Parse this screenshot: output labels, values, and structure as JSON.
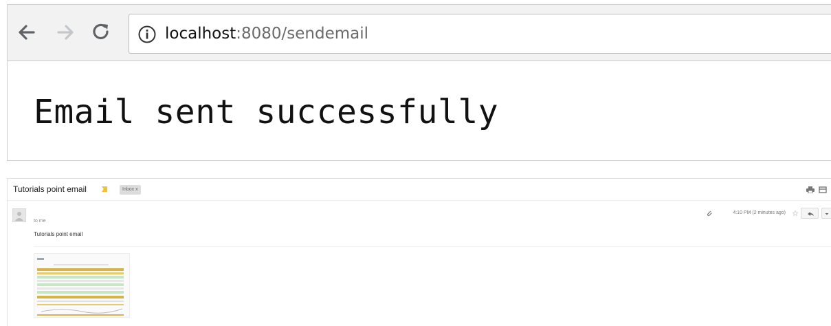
{
  "browser": {
    "url_host": "localhost",
    "url_path": ":8080/sendemail",
    "page_message": "Email sent successfully",
    "icons": [
      "back-arrow-icon",
      "forward-arrow-icon",
      "reload-icon",
      "info-icon"
    ]
  },
  "email": {
    "subject": "Tutorials point email",
    "inbox_label": "Inbox x",
    "sender_name": "to me",
    "timestamp": "4:10 PM (2 minutes ago)",
    "body_text": "Tutorials point email",
    "icons": [
      "importance-marker-icon",
      "print-icon",
      "new-window-icon",
      "avatar-icon",
      "attachment-icon",
      "star-icon",
      "reply-icon",
      "more-icon"
    ]
  },
  "colors": {
    "toolbar_bg": "#f2f2f2",
    "importance": "#f1c232",
    "attachment_band_yellow": "#d8b24a",
    "attachment_band_green": "#c6e7c4"
  }
}
